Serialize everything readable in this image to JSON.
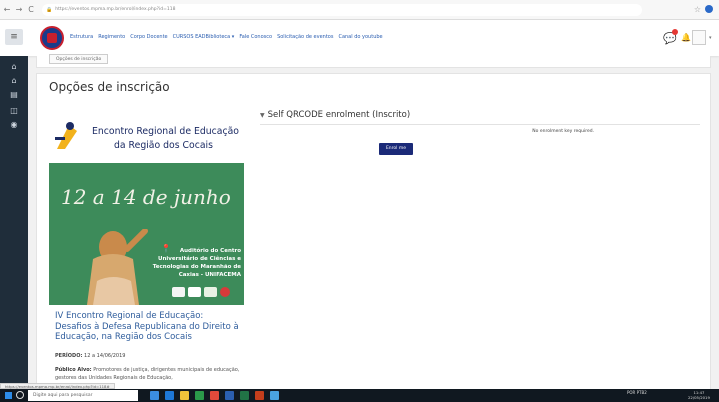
{
  "browser": {
    "url": "https://eventos.mpma.mp.br/enrol/index.php?id=118",
    "back": "←",
    "forward": "→",
    "reload": "C"
  },
  "header": {
    "menu_items": [
      "Estrutura",
      "Regimento",
      "Corpo Docente",
      "CURSOS EADBiblioteca ▾",
      "Fale Conosco",
      "Solicitação de eventos",
      "Canal do youtube"
    ]
  },
  "page": {
    "prev_button": "Opções de inscrição",
    "title": "Opções de inscrição"
  },
  "poster": {
    "title_line1": "Encontro Regional de Educação",
    "title_line2": "da Região dos Cocais",
    "dates": "12 a 14 de junho",
    "venue": "Auditório do Centro Universitário de Ciências e Tecnologias do Maranhão de Caxias - UNIFACEMA"
  },
  "event": {
    "title": "IV Encontro Regional de Educação: Desafios à Defesa Republicana do Direito à Educação, na Região dos Cocais",
    "periodo_label": "PERÍODO:",
    "periodo_value": "12 a 14/06/2019",
    "publico_label": "Público Alvo:",
    "publico_value": "Promotores de justiça, dirigentes municipais de educação, gestores das Unidades Regionais de Educação,"
  },
  "enrolment": {
    "heading": "Self QRCODE enrolment (Inscrito)",
    "message": "No enrolment key required.",
    "button": "Enrol me"
  },
  "status_url": "https://eventos.mpma.mp.br/enrol/index.php?id=118#",
  "taskbar": {
    "search_placeholder": "Digite aqui para pesquisar",
    "lang": "POR PTB2",
    "time": "11:47",
    "date": "22/05/2019"
  }
}
